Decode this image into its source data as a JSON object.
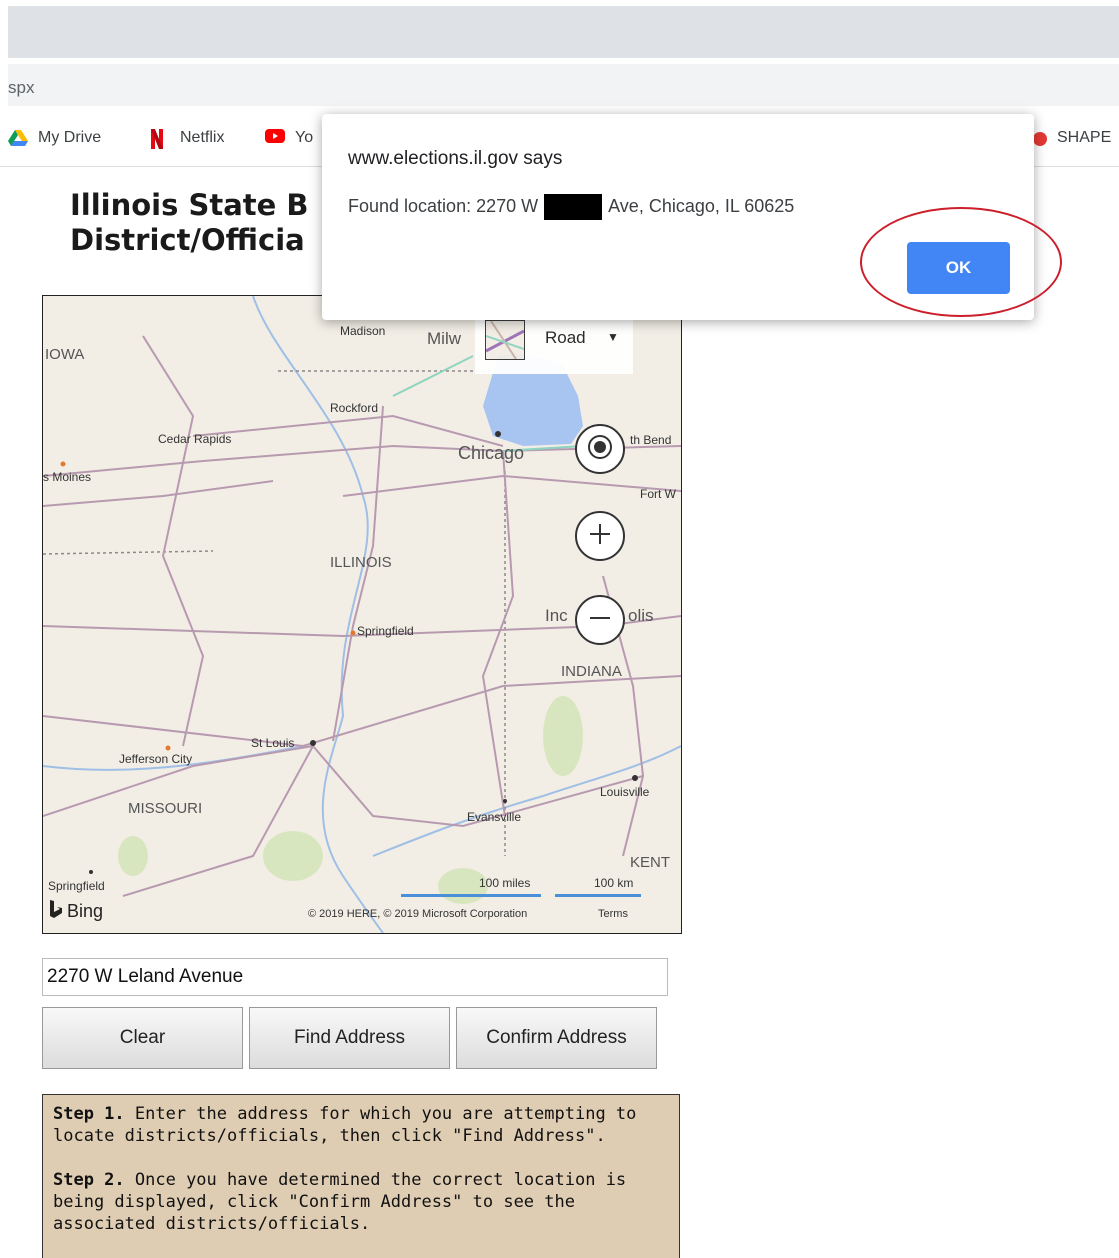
{
  "browser": {
    "address_fragment": "spx",
    "bookmarks": [
      {
        "label": "My Drive",
        "icon": "google-drive-icon"
      },
      {
        "label": "Netflix",
        "icon": "netflix-icon"
      },
      {
        "label": "Yo",
        "icon": "youtube-icon"
      },
      {
        "label": "SHAPE",
        "icon": "shape-icon"
      }
    ]
  },
  "page": {
    "heading_line1": "Illinois State B",
    "heading_line2": "District/Officia"
  },
  "map": {
    "road_label": "Road",
    "labels": {
      "madison": "Madison",
      "milwaukee": "Milw",
      "iowa": "IOWA",
      "rockford": "Rockford",
      "cedar_rapids": "Cedar Rapids",
      "chicago": "Chicago",
      "south_bend": "th Bend",
      "des_moines": "s Moines",
      "fort_wayne": "Fort W",
      "illinois": "ILLINOIS",
      "indianapolis_a": "Inc",
      "indianapolis_b": "olis",
      "springfield_il": "Springfield",
      "indiana": "INDIANA",
      "st_louis": "St Louis",
      "jefferson_city": "Jefferson City",
      "louisville": "Louisville",
      "missouri": "MISSOURI",
      "evansville": "Evansville",
      "kentucky": "KENT",
      "springfield_mo": "Springfield",
      "bing": "Bing",
      "scale_miles": "100 miles",
      "scale_km": "100 km",
      "copyright": "© 2019 HERE, © 2019 Microsoft Corporation",
      "terms": "Terms"
    }
  },
  "form": {
    "address_value": "2270 W Leland Avenue",
    "clear_label": "Clear",
    "find_label": "Find Address",
    "confirm_label": "Confirm Address"
  },
  "steps": {
    "step1_bold": "Step 1.",
    "step1_text": " Enter the address for which you are attempting to locate districts/officials, then click \"Find Address\".",
    "step2_bold": "Step 2.",
    "step2_text": " Once you have determined the correct location is being displayed, click \"Confirm Address\" to see the associated districts/officials."
  },
  "dialog": {
    "title": "www.elections.il.gov says",
    "message_prefix": "Found location: 2270 W",
    "message_suffix": "Ave, Chicago, IL 60625",
    "ok_label": "OK"
  },
  "colors": {
    "ok_button": "#4285f4",
    "annotation_circle": "#cc1f2b",
    "steps_background": "#dfcdb3"
  }
}
